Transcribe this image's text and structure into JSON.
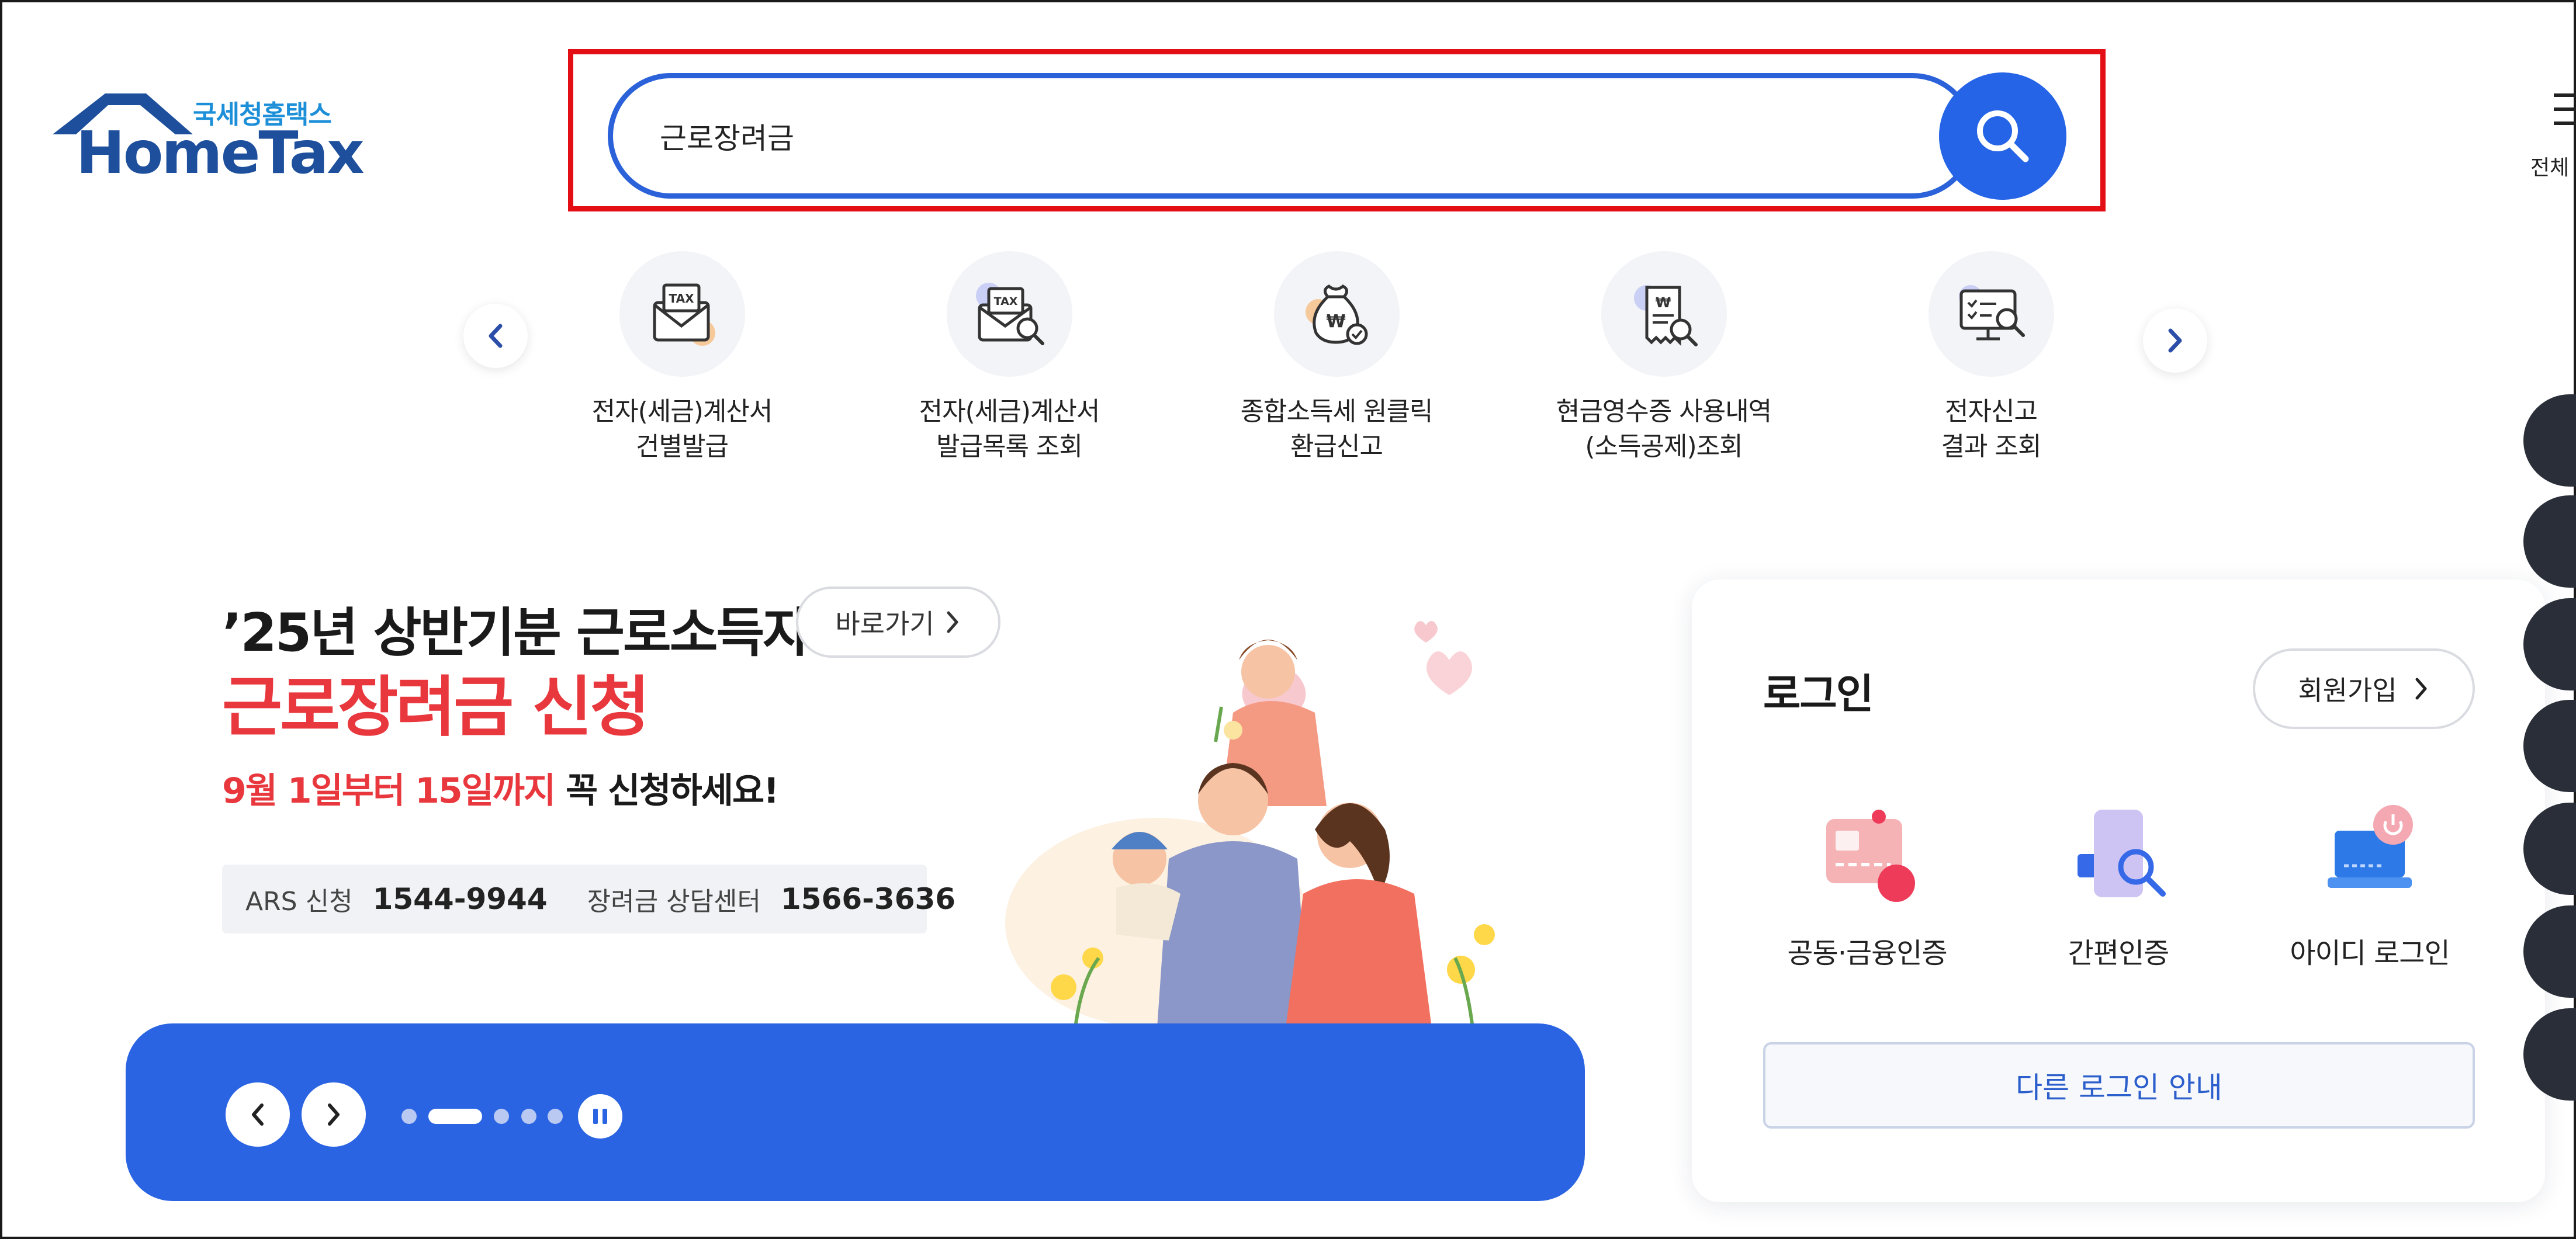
{
  "logo": {
    "subtitle": "국세청홈택스",
    "title": "HomeTax"
  },
  "search": {
    "value": "근로장려금",
    "icon": "search-icon"
  },
  "menu": {
    "label": "전체"
  },
  "quick_services": [
    {
      "label": "전자(세금)계산서\n건별발급",
      "icon": "tax-envelope-icon"
    },
    {
      "label": "전자(세금)계산서\n발급목록 조회",
      "icon": "tax-envelope-search-icon"
    },
    {
      "label": "종합소득세 원클릭\n환급신고",
      "icon": "money-bag-icon"
    },
    {
      "label": "현금영수증 사용내역\n(소득공제)조회",
      "icon": "receipt-search-icon"
    },
    {
      "label": "전자신고\n결과 조회",
      "icon": "monitor-search-icon"
    }
  ],
  "banner": {
    "line1": "’25년 상반기분 근로소득자",
    "line2": "근로장려금 신청",
    "goto_label": "바로가기",
    "line3_red": "9월 1일부터 15일까지",
    "line3_rest": " 꼭 신청하세요!",
    "ars_label": "ARS 신청",
    "ars_number": "1544-9944",
    "center_label": "장려금 상담센터",
    "center_number": "1566-3636",
    "slide_count": 5,
    "active_slide": 2
  },
  "login": {
    "title": "로그인",
    "signup_label": "회원가입",
    "options": [
      {
        "label": "공동·금융인증",
        "icon": "certificate-card-icon"
      },
      {
        "label": "간편인증",
        "icon": "phone-auth-icon"
      },
      {
        "label": "아이디 로그인",
        "icon": "laptop-power-icon"
      }
    ],
    "other_label": "다른 로그인 안내"
  },
  "colors": {
    "brand_blue": "#2564e6",
    "highlight_red": "#e30f15",
    "banner_red": "#e8373d",
    "logo_navy": "#1d4f9c"
  }
}
